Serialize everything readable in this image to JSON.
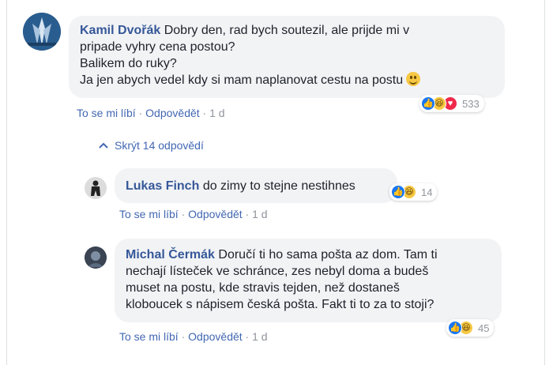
{
  "comments": [
    {
      "author": "Kamil Dvořák",
      "text_line1": "Dobry den, rad bych soutezil, ale prijde mi v",
      "text_line2": "pripade vyhry cena postou?",
      "text_line3": "Balikem do ruky?",
      "text_line4": "Ja jen abych vedel kdy si mam naplanovat cestu na postu",
      "reactions": [
        "like-icon",
        "haha-icon",
        "love-icon"
      ],
      "reaction_count": "533",
      "like_label": "To se mi líbí",
      "reply_label": "Odpovědět",
      "time": "1 d"
    },
    {
      "author": "Lukas Finch",
      "text": "do zimy to stejne nestihnes",
      "reactions": [
        "like-icon",
        "haha-icon"
      ],
      "reaction_count": "14",
      "like_label": "To se mi líbí",
      "reply_label": "Odpovědět",
      "time": "1 d"
    },
    {
      "author": "Michal Čermák",
      "text_line1": "Doručí ti ho sama pošta az dom. Tam ti",
      "text_line2": "nechají lísteček ve schránce, zes nebyl doma a budeš",
      "text_line3": "muset na postu, kde stravis tejden, než dostaneš",
      "text_line4": "kloboucek s nápisem česká pošta. Fakt ti to za to stoji?",
      "reactions": [
        "like-icon",
        "haha-icon"
      ],
      "reaction_count": "45",
      "like_label": "To se mi líbí",
      "reply_label": "Odpovědět",
      "time": "1 d"
    }
  ],
  "hide_replies_label": "Skrýt 14 odpovědí",
  "separator": "·",
  "colors": {
    "link": "#4267b2",
    "name": "#365899",
    "bubble": "#f2f3f5",
    "meta": "#90949c"
  }
}
